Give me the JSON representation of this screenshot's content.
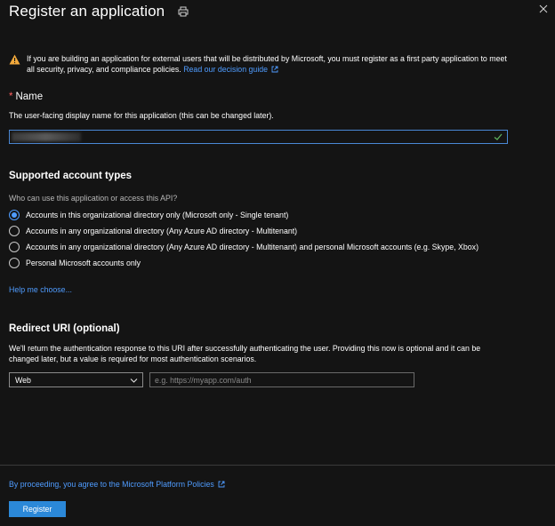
{
  "header": {
    "title": "Register an application",
    "print_icon": "printer-icon",
    "close_icon": "close-icon"
  },
  "warning": {
    "icon": "warning-triangle-icon",
    "text": "If you are building an application for external users that will be distributed by Microsoft, you must register as a first party application to meet all security, privacy, and compliance policies.",
    "link": "Read our decision guide",
    "color": "#f2a93b"
  },
  "name": {
    "required_mark": "*",
    "label": "Name",
    "description": "The user-facing display name for this application (this can be changed later).",
    "value": "",
    "valid_icon": "checkmark-icon"
  },
  "account_types": {
    "heading": "Supported account types",
    "question": "Who can use this application or access this API?",
    "options": [
      {
        "label": "Accounts in this organizational directory only (Microsoft only - Single tenant)",
        "selected": true
      },
      {
        "label": "Accounts in any organizational directory (Any Azure AD directory - Multitenant)",
        "selected": false
      },
      {
        "label": "Accounts in any organizational directory (Any Azure AD directory - Multitenant) and personal Microsoft accounts (e.g. Skype, Xbox)",
        "selected": false
      },
      {
        "label": "Personal Microsoft accounts only",
        "selected": false
      }
    ],
    "help_link": "Help me choose..."
  },
  "redirect": {
    "heading": "Redirect URI (optional)",
    "description": "We'll return the authentication response to this URI after successfully authenticating the user. Providing this now is optional and it can be changed later, but a value is required for most authentication scenarios.",
    "platform_value": "Web",
    "uri_placeholder": "e.g. https://myapp.com/auth",
    "uri_value": ""
  },
  "footer": {
    "policy_text": "By proceeding, you agree to the Microsoft Platform Policies",
    "register_label": "Register"
  },
  "colors": {
    "accent": "#2b88d8",
    "link": "#4f9cff",
    "background": "#141414"
  }
}
